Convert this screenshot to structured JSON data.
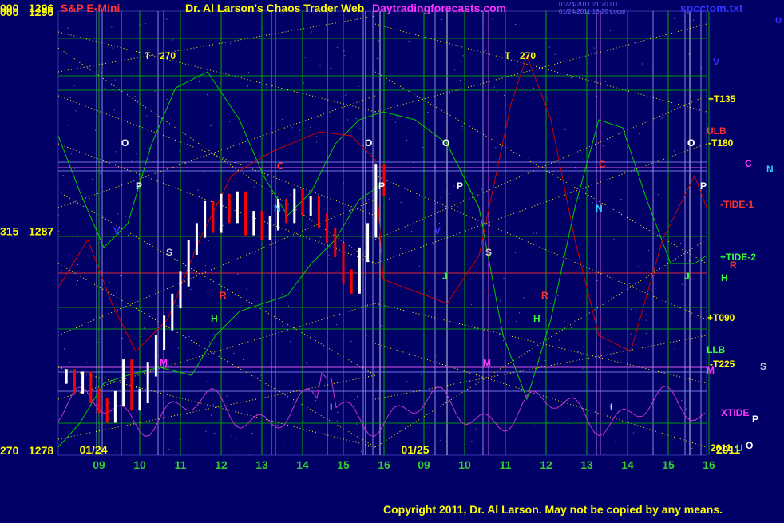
{
  "header": {
    "left_code": "000",
    "top_price": "1296",
    "instrument": "S&P E-Mini",
    "title": "Dr. Al Larson's Chaos Trader Web",
    "site": "Daytradingforecasts.com",
    "timestamp1": "01/24/2011 21:20 UT",
    "timestamp2": "01/24/2011 16:20 Local",
    "filename": "spcctom.txt",
    "corner_u": "U"
  },
  "footer": {
    "copyright": "Copyright 2011, Dr. Al Larson. May not be copied by any means."
  },
  "colors": {
    "background": "#000066",
    "grid_green": "#00aa00",
    "harmonic_yellow": "#ffff00",
    "tide_red": "#cc0000",
    "tide_green": "#00cc00",
    "xtide_magenta": "#cc33cc",
    "price_white": "#ffffff",
    "down_red": "#ff0000"
  },
  "chart_data": {
    "type": "line",
    "title": "S&P E-Mini",
    "y_axis_labels": [
      {
        "code": "000",
        "price": 1296
      },
      {
        "code": "315",
        "price": 1287
      },
      {
        "code": "270",
        "price": 1278
      }
    ],
    "ylim": [
      1278,
      1296
    ],
    "x_tick_labels": [
      "09",
      "10",
      "11",
      "12",
      "13",
      "14",
      "15",
      "16",
      "09",
      "10",
      "11",
      "12",
      "13",
      "14",
      "15",
      "16"
    ],
    "date_labels": [
      "01/24",
      "01/25",
      "2011"
    ],
    "price_series": {
      "name": "S&P E-Mini",
      "hour": [
        8.2,
        8.4,
        8.6,
        8.8,
        9.0,
        9.2,
        9.4,
        9.6,
        9.8,
        10.0,
        10.2,
        10.4,
        10.6,
        10.8,
        11.0,
        11.2,
        11.4,
        11.6,
        11.8,
        12.0,
        12.2,
        12.4,
        12.6,
        12.8,
        13.0,
        13.2,
        13.4,
        13.6,
        13.8,
        14.0,
        14.2,
        14.4,
        14.6,
        14.8,
        15.0,
        15.2,
        15.4,
        15.6,
        15.8,
        16.0
      ],
      "price": [
        1281.0,
        1280.6,
        1280.9,
        1280.2,
        1279.8,
        1279.4,
        1280.1,
        1281.4,
        1279.9,
        1280.2,
        1281.3,
        1282.4,
        1283.2,
        1284.1,
        1285.0,
        1286.3,
        1287.0,
        1287.9,
        1287.2,
        1288.2,
        1287.6,
        1288.3,
        1287.1,
        1287.5,
        1286.9,
        1287.3,
        1288.0,
        1287.6,
        1288.4,
        1287.9,
        1288.1,
        1287.4,
        1286.8,
        1286.2,
        1285.1,
        1284.7,
        1286.0,
        1287.0,
        1289.4,
        1288.7
      ]
    },
    "series": [
      {
        "name": "XTIDE",
        "color": "#cc33cc"
      },
      {
        "name": "+TIDE-2",
        "color": "#00cc00"
      },
      {
        "name": "-TIDE-1",
        "color": "#cc0000"
      }
    ],
    "right_labels": [
      {
        "text": "V",
        "color": "#3333ff"
      },
      {
        "text": "+T135",
        "color": "#ffff00"
      },
      {
        "text": "ULB",
        "color": "#ff3333"
      },
      {
        "text": "-T180",
        "color": "#ffff00"
      },
      {
        "text": "O",
        "color": "#ffffff"
      },
      {
        "text": "C",
        "color": "#ff33ff"
      },
      {
        "text": "N",
        "color": "#33ccff"
      },
      {
        "text": "P",
        "color": "#ffffff"
      },
      {
        "text": "-TIDE-1",
        "color": "#ff3333"
      },
      {
        "text": "R",
        "color": "#ff3333"
      },
      {
        "text": "+TIDE-2",
        "color": "#33ff33"
      },
      {
        "text": "H",
        "color": "#33ff33"
      },
      {
        "text": "J",
        "color": "#33ff33"
      },
      {
        "text": "+T090",
        "color": "#ffff00"
      },
      {
        "text": "LLB",
        "color": "#33ff33"
      },
      {
        "text": "-T225",
        "color": "#ffff00"
      },
      {
        "text": "M",
        "color": "#ff33ff"
      },
      {
        "text": "S",
        "color": "#cccccc"
      },
      {
        "text": "XTIDE",
        "color": "#ff33ff"
      },
      {
        "text": "P",
        "color": "#ffffff"
      },
      {
        "text": "2011",
        "color": "#ffff00"
      },
      {
        "text": "U",
        "color": "#33ff33"
      },
      {
        "text": "O",
        "color": "#ffffff"
      }
    ],
    "markers": [
      {
        "text": "T",
        "color": "#ffff00"
      },
      {
        "text": "270",
        "color": "#ffff00"
      },
      {
        "text": "T",
        "color": "#ffff00"
      },
      {
        "text": "270",
        "color": "#ffff00"
      },
      {
        "text": "O",
        "color": "#ffffff"
      },
      {
        "text": "O",
        "color": "#ffffff"
      },
      {
        "text": "O",
        "color": "#ffffff"
      },
      {
        "text": "O",
        "color": "#ffffff"
      },
      {
        "text": "P",
        "color": "#ffffff"
      },
      {
        "text": "P",
        "color": "#ffffff"
      },
      {
        "text": "P",
        "color": "#ffffff"
      },
      {
        "text": "C",
        "color": "#ff3333"
      },
      {
        "text": "C",
        "color": "#ff3333"
      },
      {
        "text": "N",
        "color": "#33ccff"
      },
      {
        "text": "N",
        "color": "#33ccff"
      },
      {
        "text": "S",
        "color": "#cccccc"
      },
      {
        "text": "S",
        "color": "#cccccc"
      },
      {
        "text": "R",
        "color": "#ff3333"
      },
      {
        "text": "R",
        "color": "#ff3333"
      },
      {
        "text": "H",
        "color": "#33ff33"
      },
      {
        "text": "H",
        "color": "#33ff33"
      },
      {
        "text": "J",
        "color": "#33ff33"
      },
      {
        "text": "J",
        "color": "#33ff33"
      },
      {
        "text": "M",
        "color": "#ff33ff"
      },
      {
        "text": "M",
        "color": "#ff33ff"
      },
      {
        "text": "I",
        "color": "#cccccc"
      },
      {
        "text": "I",
        "color": "#cccccc"
      },
      {
        "text": "V",
        "color": "#3333ff"
      },
      {
        "text": "V",
        "color": "#3333ff"
      }
    ]
  }
}
